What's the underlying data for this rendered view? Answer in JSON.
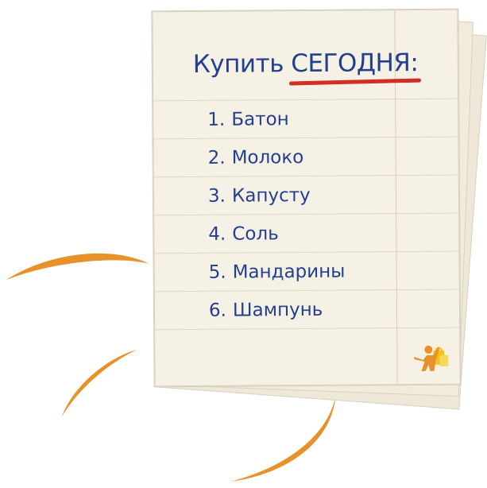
{
  "note": {
    "title_prefix": "Купить ",
    "title_highlight": "СЕГОДНЯ:",
    "items": [
      {
        "number": "1.",
        "text": "Батон"
      },
      {
        "number": "2.",
        "text": "Молоко"
      },
      {
        "number": "3.",
        "text": "Капусту"
      },
      {
        "number": "4.",
        "text": "Соль"
      },
      {
        "number": "5.",
        "text": "Мандарины"
      },
      {
        "number": "6.",
        "text": "Шампунь"
      }
    ]
  },
  "colors": {
    "ink": "#233f8e",
    "underline": "#d12f23",
    "swoosh": "#e8902a",
    "paper": "#f6f1e5"
  },
  "icons": {
    "logo": "shopper-with-bags-icon"
  }
}
